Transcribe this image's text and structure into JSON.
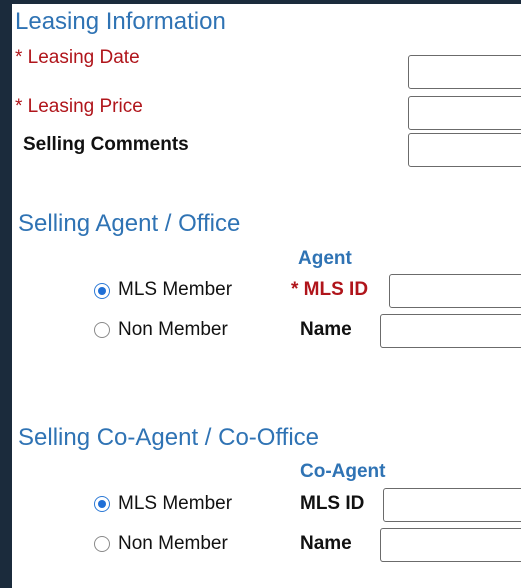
{
  "leasing": {
    "title": "Leasing Information",
    "date_label": "* Leasing Date",
    "price_label": "* Leasing Price",
    "comments_label": "Selling Comments",
    "date_value": "",
    "price_value": "",
    "comments_value": ""
  },
  "selling_agent": {
    "title": "Selling Agent / Office",
    "column_label": "Agent",
    "mls_member_label": "MLS Member",
    "non_member_label": "Non Member",
    "mls_id_label": "* MLS ID",
    "name_label": "Name",
    "selected": "MLS Member",
    "mls_id_value": "",
    "name_value": ""
  },
  "selling_co_agent": {
    "title": "Selling Co-Agent / Co-Office",
    "column_label": "Co-Agent",
    "mls_member_label": "MLS Member",
    "non_member_label": "Non Member",
    "mls_id_label": "MLS ID",
    "name_label": "Name",
    "selected": "MLS Member",
    "mls_id_value": "",
    "name_value": ""
  },
  "colors": {
    "section_title": "#2f73b4",
    "required_label": "#b0151b",
    "frame_background": "#1b2b3c",
    "radio_checked": "#1f6fd6"
  }
}
